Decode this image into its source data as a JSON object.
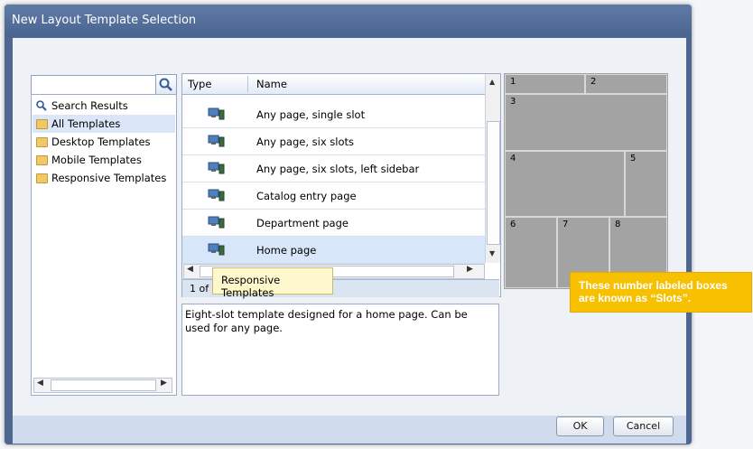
{
  "dialog": {
    "title": "New Layout Template Selection"
  },
  "tree": {
    "items": [
      {
        "label": "Search Results",
        "icon": "search-icon"
      },
      {
        "label": "All Templates",
        "icon": "folder-icon",
        "selected": true
      },
      {
        "label": "Desktop Templates",
        "icon": "folder-icon"
      },
      {
        "label": "Mobile Templates",
        "icon": "folder-icon"
      },
      {
        "label": "Responsive Templates",
        "icon": "folder-icon"
      }
    ]
  },
  "search": {
    "placeholder": "",
    "value": ""
  },
  "grid": {
    "headers": {
      "type": "Type",
      "name": "Name"
    },
    "rows": [
      {
        "name": "Any page, single slot"
      },
      {
        "name": "Any page, six slots"
      },
      {
        "name": "Any page, six slots, left sidebar"
      },
      {
        "name": "Catalog entry page"
      },
      {
        "name": "Department page"
      },
      {
        "name": "Home page",
        "selected": true
      }
    ],
    "paging_text": "1 of"
  },
  "tooltip": {
    "text": "Responsive Templates"
  },
  "description": {
    "text": "Eight-slot template designed for a home page. Can be used for any page."
  },
  "slots": {
    "labels": [
      "1",
      "2",
      "3",
      "4",
      "5",
      "6",
      "7",
      "8"
    ]
  },
  "callout": {
    "line1": "These number labeled boxes",
    "line2": "are known as “Slots”."
  },
  "footer": {
    "ok_label": "OK",
    "cancel_label": "Cancel"
  },
  "colors": {
    "accent": "#4d6791",
    "callout": "#f7c000",
    "selection": "#d7e6f8"
  }
}
